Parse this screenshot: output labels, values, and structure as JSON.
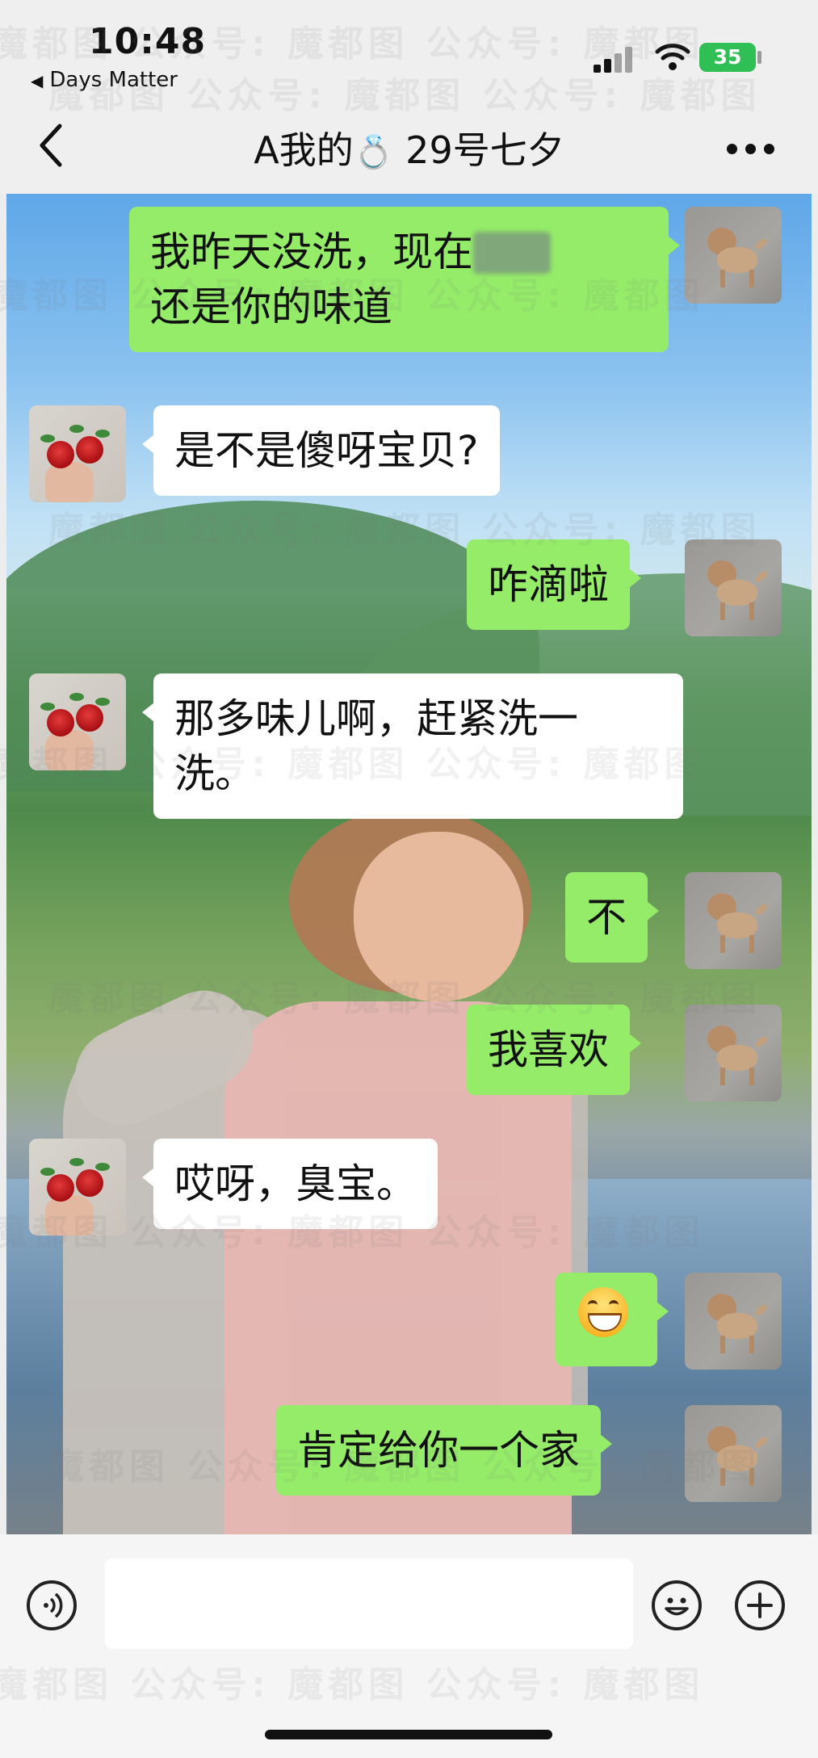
{
  "status_bar": {
    "time": "10:48",
    "back_app": "Days Matter",
    "battery": "35",
    "colors": {
      "battery": "#2fbf55"
    }
  },
  "nav": {
    "title_prefix": "A我的",
    "ring_icon": "💍",
    "title_suffix": "29号七夕"
  },
  "messages": [
    {
      "side": "me",
      "text": "我昨天没洗，现在",
      "text_line2": "还是你的味道",
      "avatar": "dog-avatar"
    },
    {
      "side": "them",
      "text": "是不是傻呀宝贝?",
      "avatar": "rose-avatar"
    },
    {
      "side": "me",
      "text": "咋滴啦",
      "avatar": "dog-avatar"
    },
    {
      "side": "them",
      "text": "那多味儿啊，赶紧洗一",
      "text_line2": "洗。",
      "avatar": "rose-avatar"
    },
    {
      "side": "me",
      "text": "不",
      "avatar": "dog-avatar"
    },
    {
      "side": "me",
      "text": "我喜欢",
      "avatar": "dog-avatar"
    },
    {
      "side": "them",
      "text": "哎呀，臭宝。",
      "avatar": "rose-avatar"
    },
    {
      "side": "me",
      "emoji": "grinning-face",
      "avatar": "dog-avatar"
    },
    {
      "side": "me",
      "text": "肯定给你一个家",
      "avatar": "dog-avatar"
    }
  ],
  "bubble_colors": {
    "me": "#95ec69",
    "them": "#ffffff"
  },
  "watermark": "魔都图 公众号: 魔都图 公众号: 魔都图"
}
